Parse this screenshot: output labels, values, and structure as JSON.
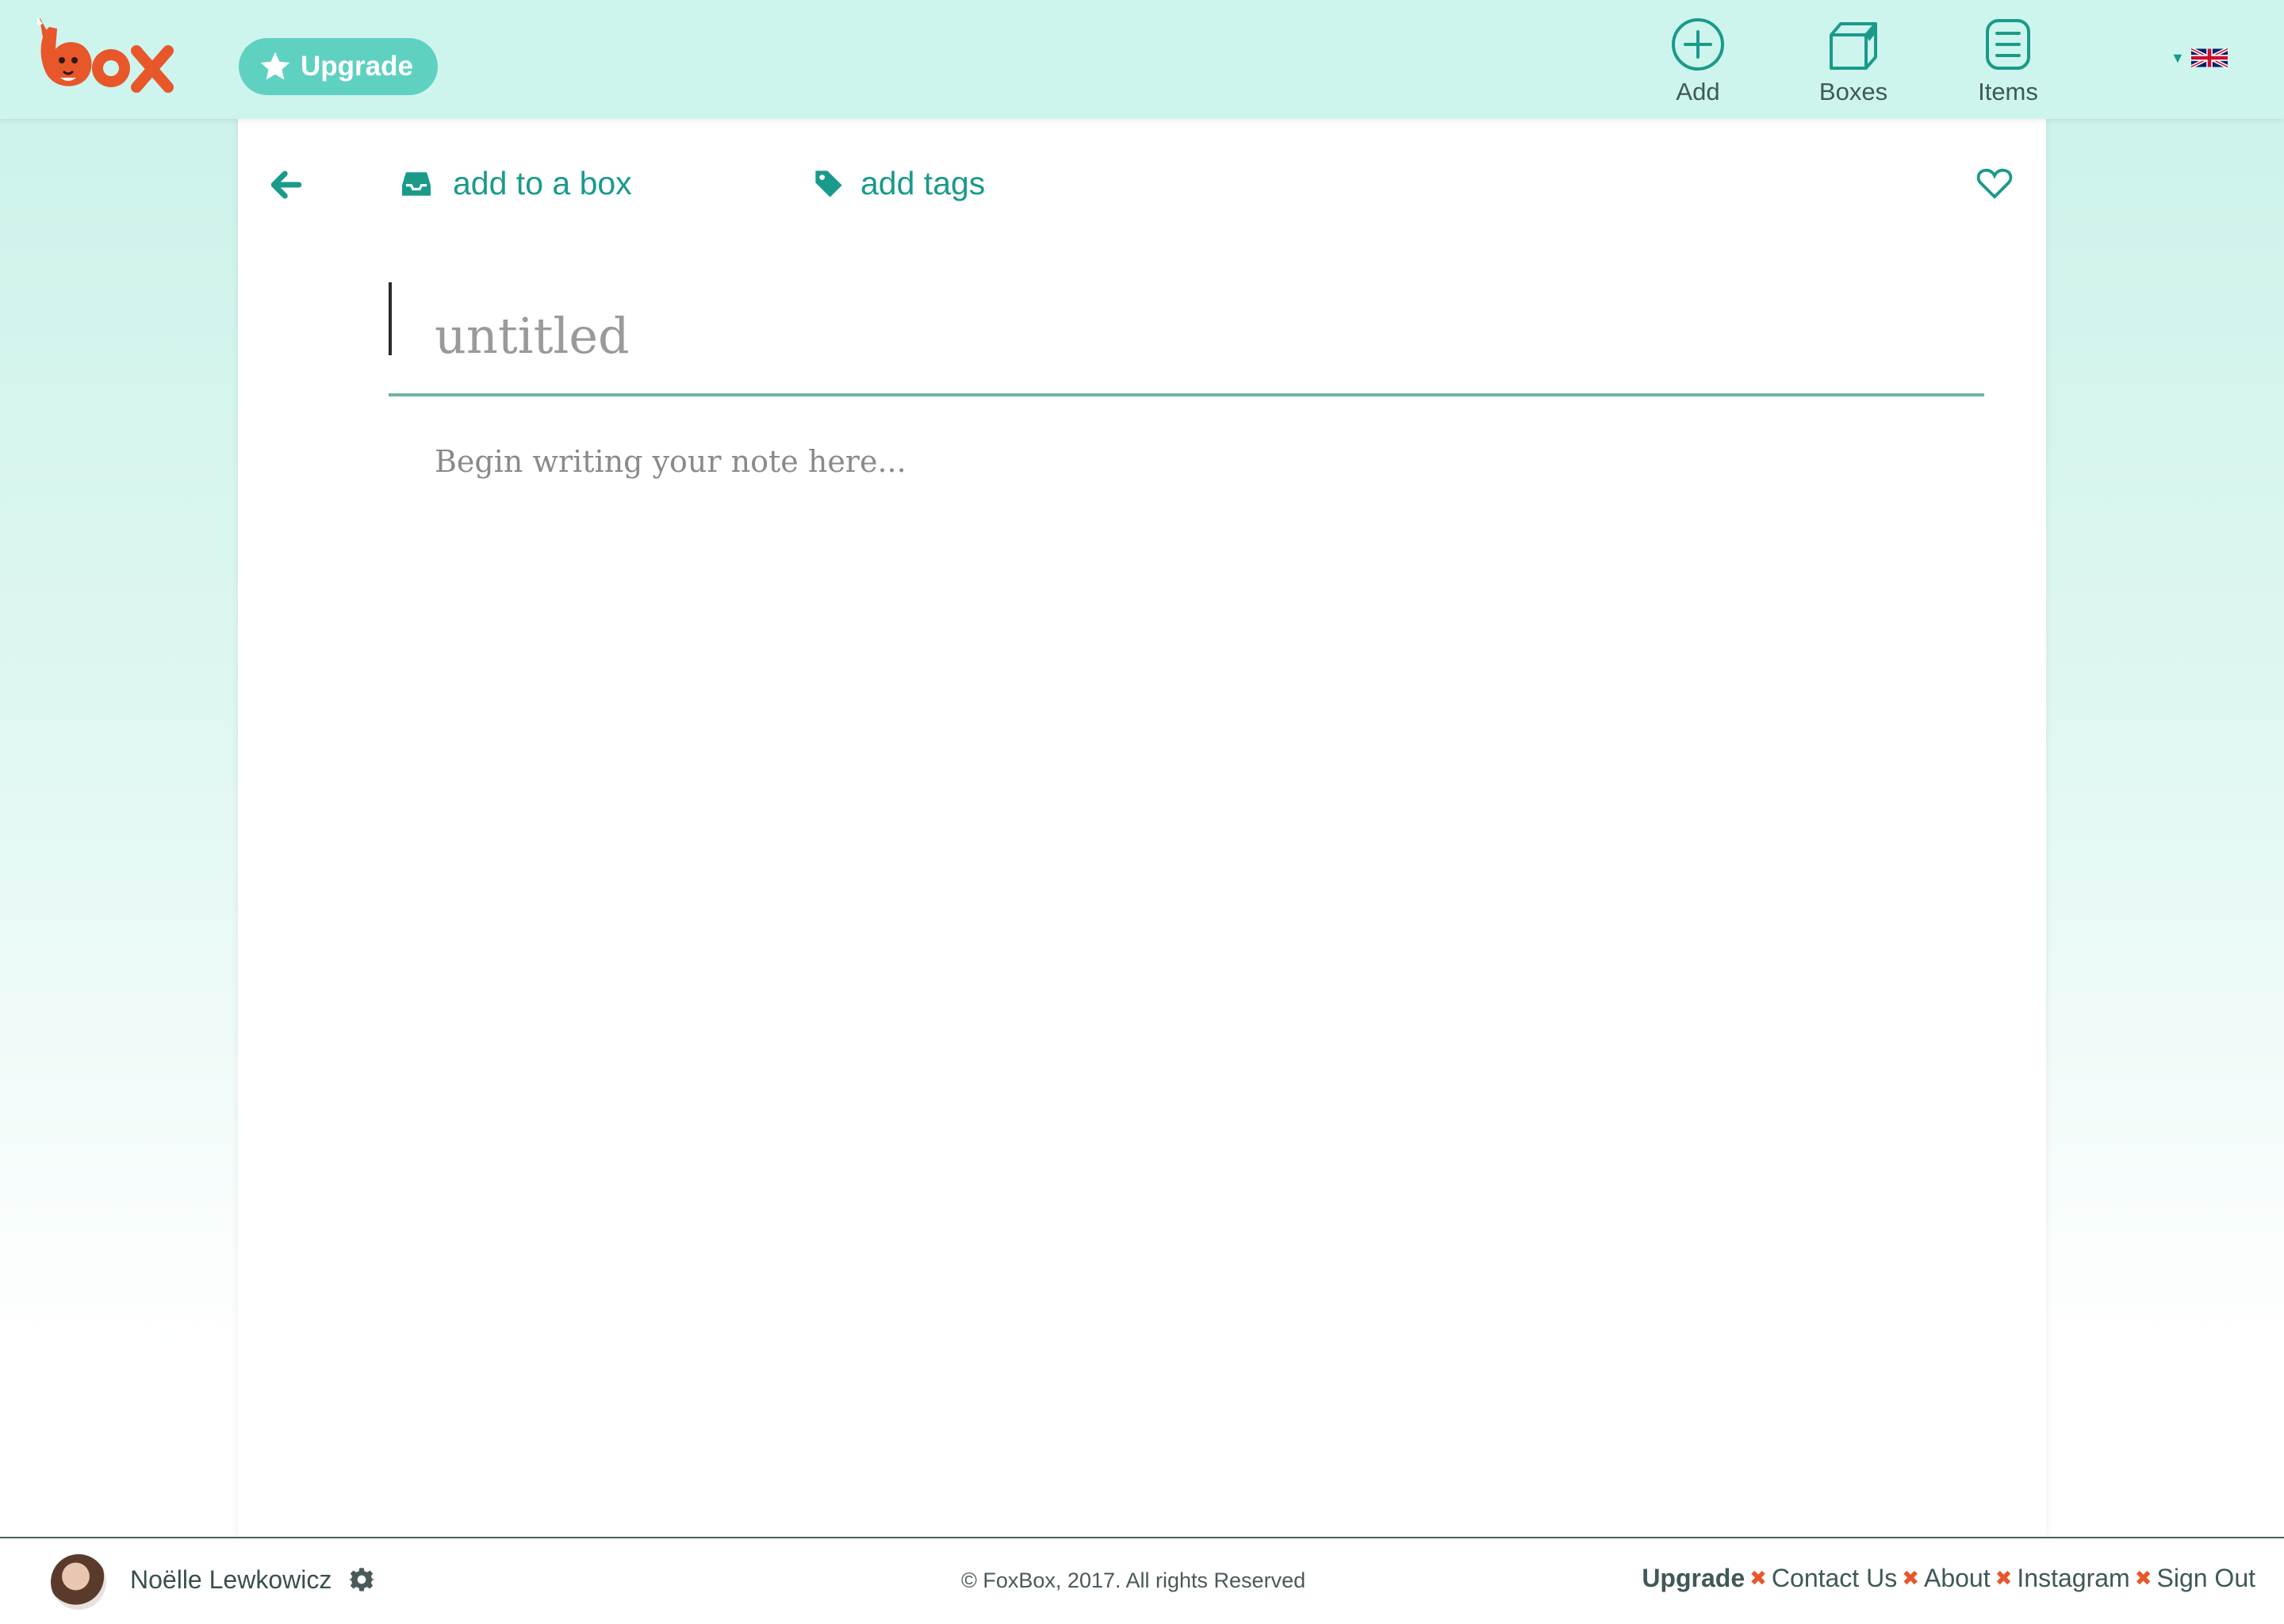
{
  "header": {
    "upgrade_label": "Upgrade",
    "nav": [
      {
        "label": "Add",
        "icon": "plus-circle-icon"
      },
      {
        "label": "Boxes",
        "icon": "box-icon"
      },
      {
        "label": "Items",
        "icon": "list-icon"
      }
    ],
    "language_icon": "uk-flag-icon"
  },
  "editor": {
    "add_to_box_label": "add to a box",
    "add_tags_label": "add tags",
    "title_placeholder": "untitled",
    "title_value": "",
    "body_placeholder": "Begin writing your note here...",
    "body_value": ""
  },
  "footer": {
    "user_name": "Noëlle Lewkowicz",
    "copyright": "© FoxBox, 2017. All rights Reserved",
    "links": [
      "Upgrade",
      "Contact Us",
      "About",
      "Instagram",
      "Sign Out"
    ]
  },
  "colors": {
    "brand_orange": "#e8572a",
    "accent_teal": "#1a9a8a",
    "header_bg": "#cdf5ee",
    "pill_teal": "#5fd1c1"
  }
}
